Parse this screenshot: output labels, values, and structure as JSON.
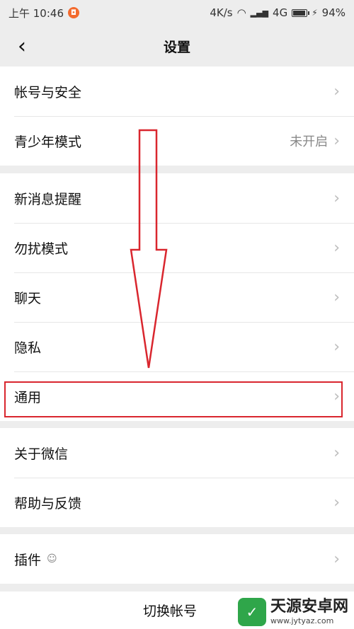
{
  "status": {
    "time": "上午 10:46",
    "notif_glyph": "◘",
    "network_speed": "4K/s",
    "signal_glyph": "▂▄▆",
    "wifi_glyph": "◠",
    "network": "4G",
    "charging_glyph": "⚡",
    "battery": "94%",
    "battery_level": 0.94
  },
  "header": {
    "back_glyph": "‹",
    "title": "设置"
  },
  "groups": [
    {
      "items": [
        {
          "label": "帐号与安全"
        },
        {
          "label": "青少年模式",
          "value": "未开启"
        }
      ]
    },
    {
      "items": [
        {
          "label": "新消息提醒"
        },
        {
          "label": "勿扰模式"
        },
        {
          "label": "聊天"
        },
        {
          "label": "隐私"
        },
        {
          "label": "通用"
        }
      ]
    },
    {
      "items": [
        {
          "label": "关于微信"
        },
        {
          "label": "帮助与反馈"
        }
      ]
    },
    {
      "items": [
        {
          "label": "插件",
          "icon": "☺"
        }
      ]
    }
  ],
  "chevron_glyph": "›",
  "bottom": {
    "switch_account": "切换帐号"
  },
  "watermark": {
    "logo_glyph": "✓",
    "title": "天源安卓网",
    "url": "www.jytyaz.com"
  },
  "colors": {
    "highlight": "#d9262e",
    "background": "#ededed",
    "logo": "#2fa64a"
  }
}
